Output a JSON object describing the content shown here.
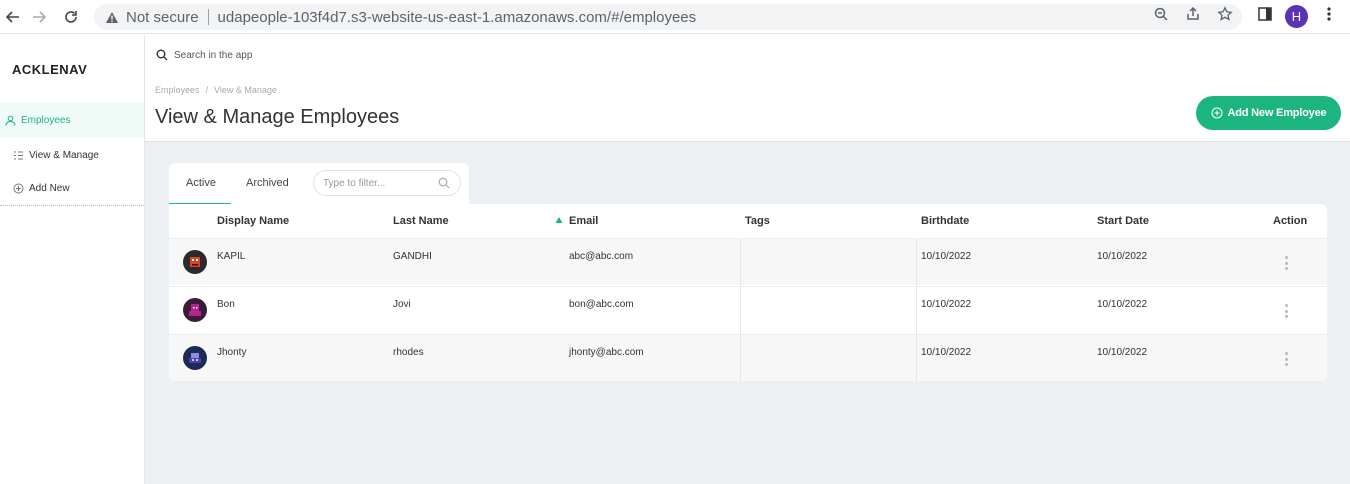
{
  "browser": {
    "security_label": "Not secure",
    "url": "udapeople-103f4d7.s3-website-us-east-1.amazonaws.com/#/employees",
    "profile_initial": "H"
  },
  "sidebar": {
    "logo": "ACKLENAV",
    "section": {
      "label": "Employees",
      "icon": "person-icon"
    },
    "items": [
      {
        "label": "View & Manage",
        "icon": "list-icon"
      },
      {
        "label": "Add New",
        "icon": "plus-circle-icon"
      }
    ]
  },
  "header": {
    "search_placeholder": "Search in the app",
    "breadcrumb": [
      "Employees",
      "/",
      "View & Manage"
    ],
    "title": "View & Manage Employees",
    "add_button": "Add New Employee"
  },
  "tabs": {
    "active": "Active",
    "archived": "Archived",
    "filter_placeholder": "Type to filter..."
  },
  "table": {
    "columns": [
      "Display Name",
      "Last Name",
      "Email",
      "Tags",
      "Birthdate",
      "Start Date",
      "Action"
    ],
    "rows": [
      {
        "display_name": "KAPIL",
        "last_name": "GANDHI",
        "email": "abc@abc.com",
        "tags": "",
        "birthdate": "10/10/2022",
        "start_date": "10/10/2022",
        "avatar_color": "#d9452c"
      },
      {
        "display_name": "Bon",
        "last_name": "Jovi",
        "email": "bon@abc.com",
        "tags": "",
        "birthdate": "10/10/2022",
        "start_date": "10/10/2022",
        "avatar_color": "#b4248c"
      },
      {
        "display_name": "Jhonty",
        "last_name": "rhodes",
        "email": "jhonty@abc.com",
        "tags": "",
        "birthdate": "10/10/2022",
        "start_date": "10/10/2022",
        "avatar_color": "#4c3fb0"
      }
    ]
  },
  "colors": {
    "accent": "#1db57f",
    "content_bg": "#edf0f2"
  }
}
